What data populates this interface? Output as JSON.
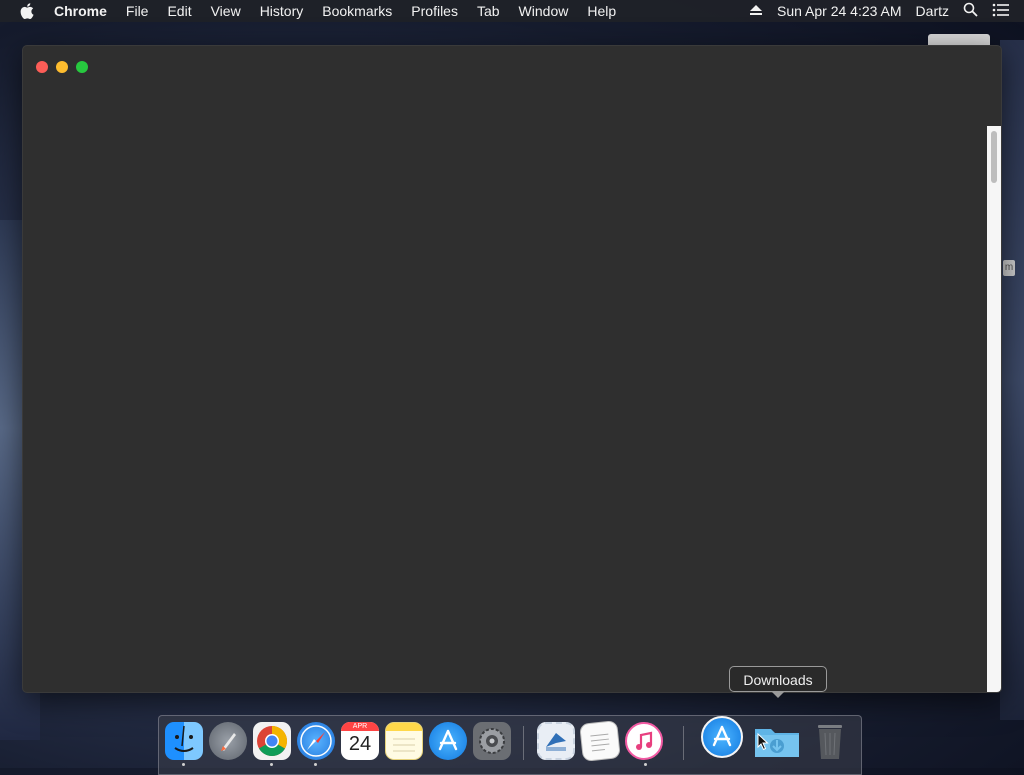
{
  "menubar": {
    "app_name": "Chrome",
    "items": [
      "File",
      "Edit",
      "View",
      "History",
      "Bookmarks",
      "Profiles",
      "Tab",
      "Window",
      "Help"
    ],
    "clock": "Sun Apr 24  4:23 AM",
    "user": "Dartz"
  },
  "dock": {
    "tooltip": "Downloads",
    "calendar": {
      "month": "APR",
      "day": "24"
    },
    "apps": [
      "Finder",
      "Launchpad",
      "Google Chrome",
      "Safari",
      "Calendar",
      "Notes",
      "App Store",
      "System Preferences",
      "Mail",
      "TextEdit",
      "iTunes",
      "App Store Installer",
      "Downloads",
      "Trash"
    ]
  },
  "colors": {
    "close": "#fc5d57",
    "minimize": "#fdbc2e",
    "maximize": "#27c93f",
    "window_bg": "#2f2f2f",
    "menubar_bg": "#202228"
  }
}
